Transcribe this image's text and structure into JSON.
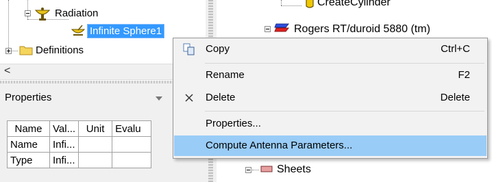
{
  "left_tree": {
    "items": [
      {
        "label": "Radiation"
      },
      {
        "label": "Infinite Sphere1"
      },
      {
        "label": "Definitions"
      }
    ]
  },
  "hscroll": {
    "left_arrow": "<"
  },
  "properties": {
    "title": "Properties",
    "columns": [
      "Name",
      "Val...",
      "Unit",
      "Evalu"
    ],
    "rows": [
      {
        "name": "Name",
        "value": "Infi..."
      },
      {
        "name": "Type",
        "value": "Infi..."
      }
    ]
  },
  "right_tree": {
    "items": [
      {
        "label": "CreateCylinder"
      },
      {
        "label": "Rogers RT/duroid 5880 (tm)"
      },
      {
        "label": "Sheets"
      }
    ]
  },
  "context_menu": {
    "items": [
      {
        "label": "Copy",
        "shortcut": "Ctrl+C",
        "icon": "copy-icon"
      },
      {
        "label": "Rename",
        "shortcut": "F2"
      },
      {
        "label": "Delete",
        "shortcut": "Delete",
        "icon": "delete-x-icon"
      },
      {
        "label": "Properties..."
      },
      {
        "label": "Compute Antenna Parameters...",
        "highlighted": true
      }
    ]
  },
  "colors": {
    "selection": "#3399ff",
    "menu_highlight": "#99ccf7",
    "menu_background": "#f2f2f2"
  }
}
